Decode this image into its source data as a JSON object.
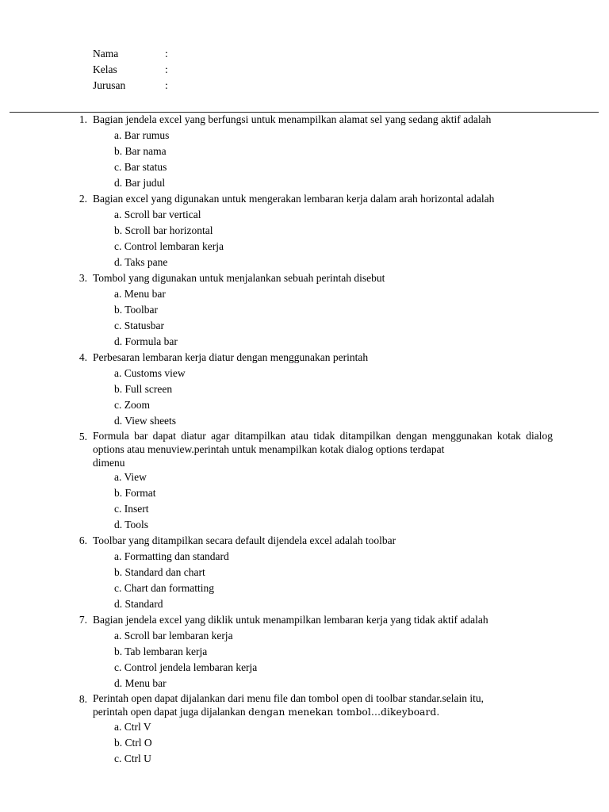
{
  "document": {
    "identity_fields": [
      {
        "label": "Nama",
        "separator": ":",
        "value": ""
      },
      {
        "label": "Kelas",
        "separator": ":",
        "value": ""
      },
      {
        "label": "Jurusan",
        "separator": ":",
        "value": ""
      }
    ],
    "questions": [
      {
        "number": "1.",
        "text": "Bagian jendela excel yang berfungsi untuk menampilkan alamat  sel yang sedang aktif adalah",
        "justified": false,
        "options": [
          "a. Bar rumus",
          "b. Bar nama",
          "c. Bar status",
          "d. Bar judul"
        ]
      },
      {
        "number": "2.",
        "text": "Bagian excel yang digunakan untuk mengerakan lembaran kerja dalam arah horizontal adalah",
        "justified": false,
        "options": [
          "a. Scroll bar vertical",
          "b. Scroll bar horizontal",
          "c. Control lembaran kerja",
          "d. Taks pane"
        ]
      },
      {
        "number": "3.",
        "text": "Tombol yang digunakan untuk menjalankan sebuah perintah disebut",
        "justified": false,
        "options": [
          "a. Menu bar",
          "b. Toolbar",
          "c. Statusbar",
          "d. Formula bar"
        ]
      },
      {
        "number": "4.",
        "text": "Perbesaran lembaran kerja diatur dengan menggunakan perintah",
        "justified": false,
        "options": [
          "a. Customs view",
          "b. Full screen",
          "c. Zoom",
          "d. View sheets"
        ]
      },
      {
        "number": "5.",
        "text": "Formula bar dapat diatur agar ditampilkan atau tidak ditampilkan dengan menggunakan kotak dialog options atau menuview.perintah untuk menampilkan kotak dialog options terdapat",
        "text_lastline": "dimenu",
        "justified": true,
        "options": [
          "a. View",
          "b. Format",
          "c. Insert",
          "d. Tools"
        ]
      },
      {
        "number": "6.",
        "text": "Toolbar yang ditampilkan secara default dijendela excel adalah toolbar",
        "justified": false,
        "options": [
          "a. Formatting dan standard",
          "b. Standard dan chart",
          "c. Chart dan formatting",
          "d. Standard"
        ]
      },
      {
        "number": "7.",
        "text": "Bagian jendela excel yang diklik untuk menampilkan lembaran kerja yang tidak aktif adalah",
        "justified": false,
        "options": [
          "a. Scroll bar lembaran kerja",
          "b. Tab lembaran kerja",
          "c. Control jendela lembaran kerja",
          "d. Menu bar"
        ]
      },
      {
        "number": "8.",
        "text": "Perintah open dapat dijalankan dari menu file dan tombol open di toolbar standar.selain itu,",
        "text_lastline_prefix": "perintah open dapat juga dijalankan ",
        "text_lastline_alt": "dengan menekan tombol…dikeyboard.",
        "justified": true,
        "options": [
          "a. Ctrl V",
          "b. Ctrl O",
          "c. Ctrl U"
        ]
      }
    ]
  },
  "colors": {
    "page_background": "#ffffff",
    "text": "#000000",
    "rule": "#2b2b2b"
  }
}
